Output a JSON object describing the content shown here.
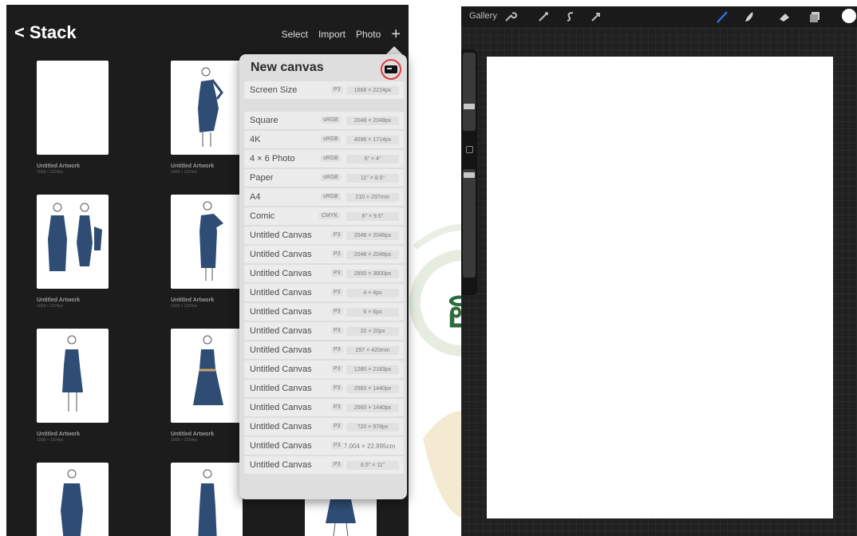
{
  "left_app": {
    "header": {
      "back_label": "Stack",
      "select_label": "Select",
      "import_label": "Import",
      "photo_label": "Photo",
      "add_label": "+"
    },
    "artworks": [
      {
        "title": "Untitled Artwork",
        "size": "1668 × 2224px"
      },
      {
        "title": "Untitled Artwork",
        "size": "1668 × 2224px"
      },
      {
        "title": "Untitled Artwork",
        "size": "1668 × 2224px"
      },
      {
        "title": "Untitled Artwork",
        "size": "1668 × 2224px"
      },
      {
        "title": "Untitled Artwork",
        "size": "1668 × 2224px"
      },
      {
        "title": "Untitled Artwork",
        "size": "1668 × 2224px"
      }
    ],
    "new_canvas": {
      "title": "New canvas",
      "presets": [
        {
          "name": "Screen Size",
          "color_space": "P3",
          "dimensions": "1668 × 2224px"
        },
        {
          "name": "Square",
          "color_space": "sRGB",
          "dimensions": "2048 × 2048px"
        },
        {
          "name": "4K",
          "color_space": "sRGB",
          "dimensions": "4096 × 1714px"
        },
        {
          "name": "4 × 6 Photo",
          "color_space": "sRGB",
          "dimensions": "6\" × 4\""
        },
        {
          "name": "Paper",
          "color_space": "sRGB",
          "dimensions": "11\" × 8.5\""
        },
        {
          "name": "A4",
          "color_space": "sRGB",
          "dimensions": "210 × 297mm"
        },
        {
          "name": "Comic",
          "color_space": "CMYK",
          "dimensions": "6\" × 9.5\""
        },
        {
          "name": "Untitled Canvas",
          "color_space": "P3",
          "dimensions": "2048 × 2048px"
        },
        {
          "name": "Untitled Canvas",
          "color_space": "P3",
          "dimensions": "2048 × 2048px"
        },
        {
          "name": "Untitled Canvas",
          "color_space": "P3",
          "dimensions": "2850 × 3600px"
        },
        {
          "name": "Untitled Canvas",
          "color_space": "P3",
          "dimensions": "4 × 4px"
        },
        {
          "name": "Untitled Canvas",
          "color_space": "P3",
          "dimensions": "6 × 6px"
        },
        {
          "name": "Untitled Canvas",
          "color_space": "P3",
          "dimensions": "20 × 20px"
        },
        {
          "name": "Untitled Canvas",
          "color_space": "P3",
          "dimensions": "297 × 420mm"
        },
        {
          "name": "Untitled Canvas",
          "color_space": "P3",
          "dimensions": "1280 × 2183px"
        },
        {
          "name": "Untitled Canvas",
          "color_space": "P3",
          "dimensions": "2560 × 1440px"
        },
        {
          "name": "Untitled Canvas",
          "color_space": "P3",
          "dimensions": "2560 × 1440px"
        },
        {
          "name": "Untitled Canvas",
          "color_space": "P3",
          "dimensions": "720 × 978px"
        },
        {
          "name": "Untitled Canvas",
          "color_space": "P3",
          "dimensions": "7.004 × 22.995cm"
        },
        {
          "name": "Untitled Canvas",
          "color_space": "P3",
          "dimensions": "8.5\" × 11\""
        }
      ]
    }
  },
  "right_app": {
    "toolbar": {
      "gallery_label": "Gallery",
      "left_tools": [
        "wrench-icon",
        "magic-wand-icon",
        "selection-icon",
        "transform-icon"
      ],
      "right_tools": [
        "brush-icon",
        "smudge-icon",
        "eraser-icon",
        "layers-icon"
      ],
      "active_tool": "brush-icon",
      "active_color": "#2f6fe0",
      "current_color": "#ffffff"
    }
  },
  "colors": {
    "dress_blue": "#2f4d74",
    "highlight_ring": "#e03b3b"
  }
}
